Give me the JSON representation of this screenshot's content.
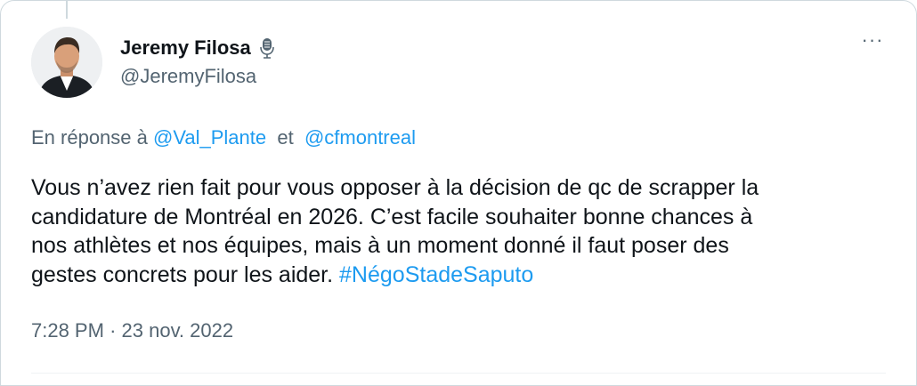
{
  "author": {
    "display_name": "Jeremy Filosa",
    "handle": "@JeremyFilosa",
    "badge_icon": "microphone-icon",
    "avatar_icon": "profile-photo"
  },
  "reply": {
    "prefix": "En réponse à",
    "mention_1": "@Val_Plante",
    "connector": "et",
    "mention_2": "@cfmontreal"
  },
  "tweet": {
    "lines": [
      "Vous n’avez rien fait pour vous opposer à la décision de qc de scrapper la",
      "candidature de Montréal en 2026. C’est facile souhaiter bonne chances à",
      "nos athlètes et nos équipes, mais à un moment donné il faut poser des",
      "gestes concrets pour les aider."
    ],
    "hashtag": "#NégoStadeSaputo"
  },
  "meta": {
    "time": "7:28 PM",
    "separator": "·",
    "date": "23 nov. 2022"
  },
  "menu": {
    "more_label": "···"
  },
  "colors": {
    "text": "#0f1419",
    "secondary": "#536471",
    "link": "#1d9bf0",
    "border": "#cfd9de"
  }
}
